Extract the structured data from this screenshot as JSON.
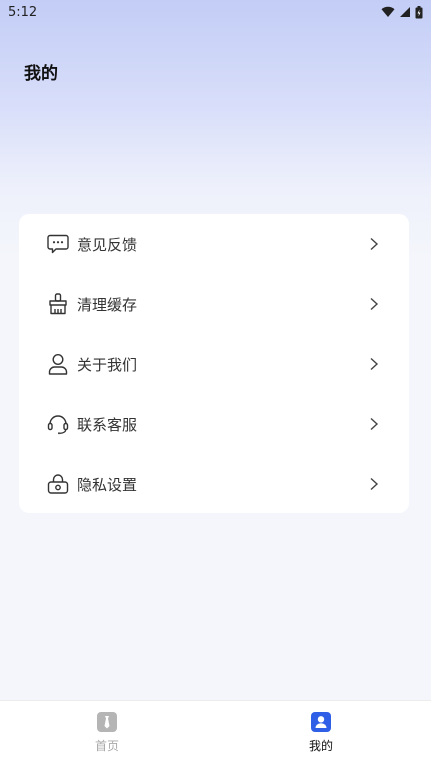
{
  "status_bar": {
    "time": "5:12"
  },
  "page": {
    "title": "我的"
  },
  "menu": {
    "items": [
      {
        "label": "意见反馈",
        "icon": "feedback-icon"
      },
      {
        "label": "清理缓存",
        "icon": "broom-icon"
      },
      {
        "label": "关于我们",
        "icon": "person-icon"
      },
      {
        "label": "联系客服",
        "icon": "headset-icon"
      },
      {
        "label": "隐私设置",
        "icon": "lock-icon"
      }
    ]
  },
  "bottom_nav": {
    "items": [
      {
        "label": "首页",
        "icon": "home-tie-icon",
        "active": false
      },
      {
        "label": "我的",
        "icon": "profile-icon",
        "active": true
      }
    ]
  },
  "colors": {
    "accent": "#2f5fe6",
    "inactive": "#a8a8a8",
    "card_bg": "#ffffff"
  }
}
